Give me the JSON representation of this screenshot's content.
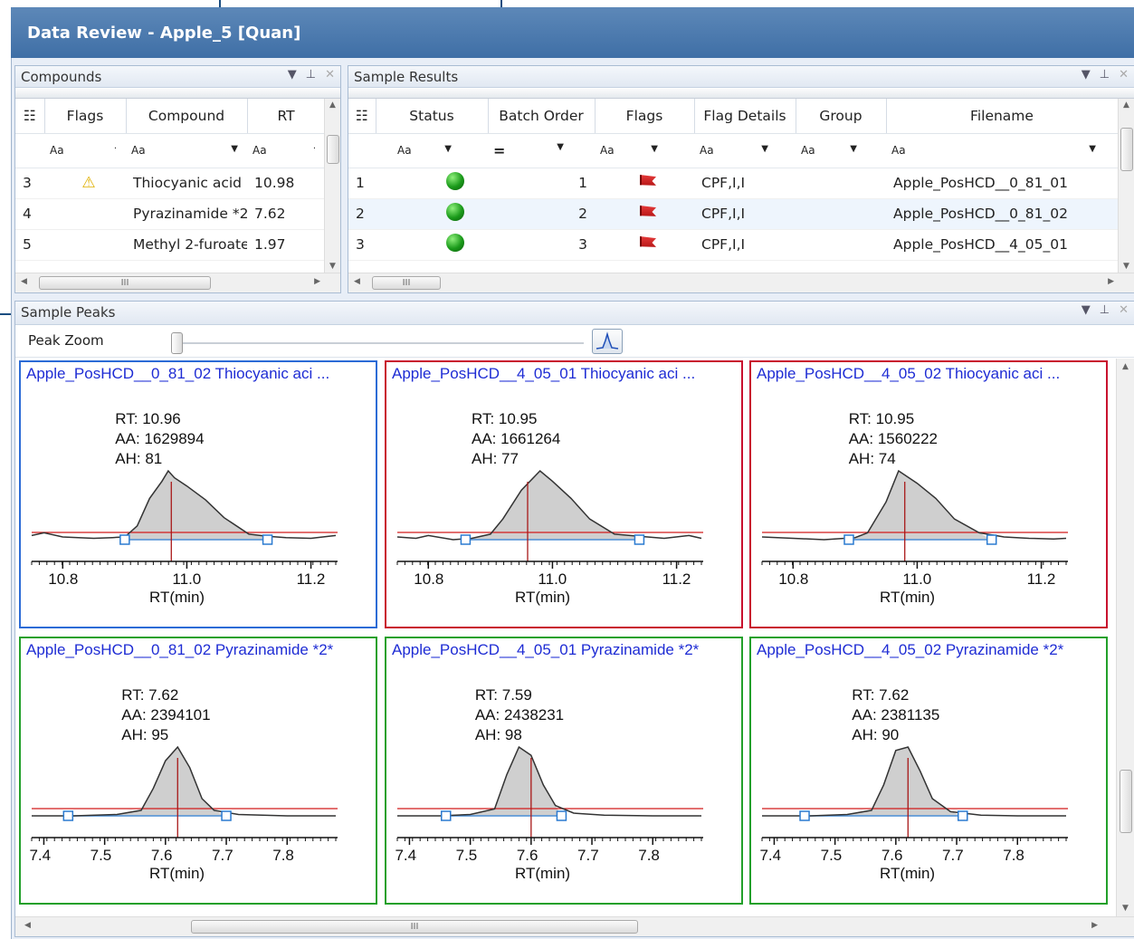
{
  "window": {
    "title": "Data Review - Apple_5 [Quan]"
  },
  "compounds": {
    "title": "Compounds",
    "headers": {
      "flags": "Flags",
      "compound": "Compound",
      "rt": "RT"
    },
    "filter_icon": "Aa",
    "rows": [
      {
        "n": "3",
        "flag": "warning-icon",
        "compound": "Thiocyanic acid",
        "rt": "10.98"
      },
      {
        "n": "4",
        "flag": "",
        "compound": "Pyrazinamide *2*",
        "rt": "7.62"
      },
      {
        "n": "5",
        "flag": "",
        "compound": "Methyl 2-furoate",
        "rt": "1.97"
      }
    ],
    "scroll_grip": "III"
  },
  "sample_results": {
    "title": "Sample Results",
    "headers": {
      "status": "Status",
      "batch_order": "Batch Order",
      "flags": "Flags",
      "flag_details": "Flag Details",
      "group": "Group",
      "filename": "Filename"
    },
    "filter_eq": "=",
    "filter_icon": "Aa",
    "rows": [
      {
        "n": "1",
        "status": "green",
        "batch": "1",
        "flag": "red-flag",
        "details": "CPF,I,I",
        "group": "",
        "filename": "Apple_PosHCD__0_81_01"
      },
      {
        "n": "2",
        "status": "green",
        "batch": "2",
        "flag": "red-flag",
        "details": "CPF,I,I",
        "group": "",
        "filename": "Apple_PosHCD__0_81_02"
      },
      {
        "n": "3",
        "status": "green",
        "batch": "3",
        "flag": "red-flag",
        "details": "CPF,I,I",
        "group": "",
        "filename": "Apple_PosHCD__4_05_01"
      }
    ],
    "scroll_grip": "III"
  },
  "sample_peaks": {
    "title": "Sample Peaks",
    "peak_zoom_label": "Peak Zoom",
    "peak_zoom_level": 0,
    "scroll_grip": "III",
    "xlabel": "RT(min)"
  },
  "colors": {
    "flagged": "#c8102e",
    "ok": "#22a02a",
    "selected": "#2b6bd6",
    "title_text": "#1e2cd4"
  },
  "chart_data": [
    {
      "type": "line",
      "title": "Apple_PosHCD__0_81_02   Thiocyanic aci ...",
      "status": "selected",
      "stats": [
        "RT: 10.96",
        "AA: 1629894",
        "AH: 81"
      ],
      "xlabel": "RT(min)",
      "xlim": [
        10.75,
        11.24
      ],
      "ticks": [
        10.8,
        11.0,
        11.2
      ],
      "tick_labels": [
        "10.8",
        "11.0",
        "11.2"
      ],
      "rt_line": 10.975,
      "markers": [
        10.9,
        11.13
      ],
      "x": [
        10.75,
        10.77,
        10.8,
        10.85,
        10.88,
        10.9,
        10.92,
        10.94,
        10.96,
        10.97,
        10.98,
        11.0,
        11.03,
        11.06,
        11.1,
        11.13,
        11.16,
        11.2,
        11.24
      ],
      "y": [
        6,
        10,
        4,
        2,
        3,
        4,
        20,
        60,
        85,
        100,
        90,
        78,
        58,
        32,
        8,
        5,
        3,
        2,
        6
      ]
    },
    {
      "type": "line",
      "title": "Apple_PosHCD__4_05_01   Thiocyanic aci ...",
      "status": "flagged",
      "stats": [
        "RT: 10.95",
        "AA: 1661264",
        "AH: 77"
      ],
      "xlabel": "RT(min)",
      "xlim": [
        10.75,
        11.24
      ],
      "ticks": [
        10.8,
        11.0,
        11.2
      ],
      "tick_labels": [
        "10.8",
        "11.0",
        "11.2"
      ],
      "rt_line": 10.96,
      "markers": [
        10.86,
        11.14
      ],
      "x": [
        10.75,
        10.78,
        10.8,
        10.84,
        10.87,
        10.9,
        10.92,
        10.95,
        10.98,
        11.0,
        11.03,
        11.06,
        11.1,
        11.14,
        11.18,
        11.22,
        11.24
      ],
      "y": [
        4,
        2,
        6,
        0,
        2,
        8,
        30,
        72,
        100,
        85,
        60,
        30,
        8,
        5,
        2,
        6,
        2
      ]
    },
    {
      "type": "line",
      "title": "Apple_PosHCD__4_05_02   Thiocyanic aci ...",
      "status": "flagged",
      "stats": [
        "RT: 10.95",
        "AA: 1560222",
        "AH: 74"
      ],
      "xlabel": "RT(min)",
      "xlim": [
        10.75,
        11.24
      ],
      "ticks": [
        10.8,
        11.0,
        11.2
      ],
      "tick_labels": [
        "10.8",
        "11.0",
        "11.2"
      ],
      "rt_line": 10.98,
      "markers": [
        10.89,
        11.12
      ],
      "x": [
        10.75,
        10.8,
        10.85,
        10.9,
        10.92,
        10.95,
        10.97,
        11.0,
        11.03,
        11.06,
        11.1,
        11.14,
        11.18,
        11.22,
        11.24
      ],
      "y": [
        4,
        2,
        0,
        3,
        10,
        55,
        100,
        82,
        60,
        30,
        10,
        4,
        2,
        1,
        2
      ]
    },
    {
      "type": "line",
      "title": "Apple_PosHCD__0_81_02   Pyrazinamide *2*",
      "status": "ok",
      "stats": [
        "RT: 7.62",
        "AA: 2394101",
        "AH: 95"
      ],
      "xlabel": "RT(min)",
      "xlim": [
        7.38,
        7.88
      ],
      "ticks": [
        7.4,
        7.5,
        7.6,
        7.7,
        7.8
      ],
      "tick_labels": [
        "7.4",
        "7.5",
        "7.6",
        "7.7",
        "7.8"
      ],
      "rt_line": 7.62,
      "markers": [
        7.44,
        7.7
      ],
      "x": [
        7.38,
        7.45,
        7.52,
        7.56,
        7.58,
        7.6,
        7.62,
        7.64,
        7.66,
        7.68,
        7.72,
        7.8,
        7.88
      ],
      "y": [
        0,
        0,
        2,
        8,
        40,
        80,
        100,
        70,
        25,
        8,
        2,
        0,
        0
      ]
    },
    {
      "type": "line",
      "title": "Apple_PosHCD__4_05_01   Pyrazinamide *2*",
      "status": "ok",
      "stats": [
        "RT: 7.59",
        "AA: 2438231",
        "AH: 98"
      ],
      "xlabel": "RT(min)",
      "xlim": [
        7.38,
        7.88
      ],
      "ticks": [
        7.4,
        7.5,
        7.6,
        7.7,
        7.8
      ],
      "tick_labels": [
        "7.4",
        "7.5",
        "7.6",
        "7.7",
        "7.8"
      ],
      "rt_line": 7.6,
      "markers": [
        7.46,
        7.65
      ],
      "x": [
        7.38,
        7.45,
        7.5,
        7.54,
        7.56,
        7.58,
        7.6,
        7.62,
        7.64,
        7.67,
        7.72,
        7.8,
        7.88
      ],
      "y": [
        0,
        0,
        2,
        10,
        60,
        100,
        88,
        45,
        15,
        4,
        1,
        0,
        0
      ]
    },
    {
      "type": "line",
      "title": "Apple_PosHCD__4_05_02   Pyrazinamide *2*",
      "status": "ok",
      "stats": [
        "RT: 7.62",
        "AA: 2381135",
        "AH: 90"
      ],
      "xlabel": "RT(min)",
      "xlim": [
        7.38,
        7.88
      ],
      "ticks": [
        7.4,
        7.5,
        7.6,
        7.7,
        7.8
      ],
      "tick_labels": [
        "7.4",
        "7.5",
        "7.6",
        "7.7",
        "7.8"
      ],
      "rt_line": 7.62,
      "markers": [
        7.45,
        7.71
      ],
      "x": [
        7.38,
        7.46,
        7.52,
        7.56,
        7.58,
        7.6,
        7.62,
        7.64,
        7.66,
        7.69,
        7.74,
        7.8,
        7.88
      ],
      "y": [
        0,
        0,
        2,
        8,
        45,
        95,
        100,
        65,
        25,
        6,
        1,
        0,
        0
      ]
    }
  ]
}
